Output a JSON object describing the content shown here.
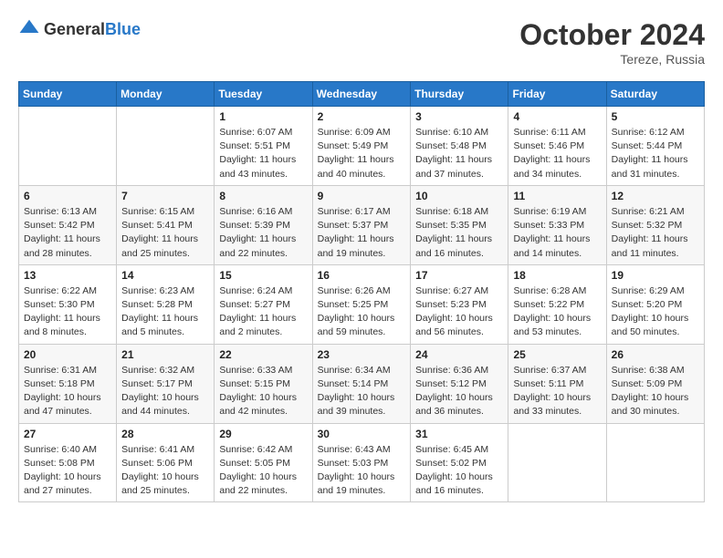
{
  "header": {
    "logo_general": "General",
    "logo_blue": "Blue",
    "month_title": "October 2024",
    "location": "Tereze, Russia"
  },
  "days_of_week": [
    "Sunday",
    "Monday",
    "Tuesday",
    "Wednesday",
    "Thursday",
    "Friday",
    "Saturday"
  ],
  "weeks": [
    [
      {
        "day": "",
        "info": ""
      },
      {
        "day": "",
        "info": ""
      },
      {
        "day": "1",
        "info": "Sunrise: 6:07 AM\nSunset: 5:51 PM\nDaylight: 11 hours and 43 minutes."
      },
      {
        "day": "2",
        "info": "Sunrise: 6:09 AM\nSunset: 5:49 PM\nDaylight: 11 hours and 40 minutes."
      },
      {
        "day": "3",
        "info": "Sunrise: 6:10 AM\nSunset: 5:48 PM\nDaylight: 11 hours and 37 minutes."
      },
      {
        "day": "4",
        "info": "Sunrise: 6:11 AM\nSunset: 5:46 PM\nDaylight: 11 hours and 34 minutes."
      },
      {
        "day": "5",
        "info": "Sunrise: 6:12 AM\nSunset: 5:44 PM\nDaylight: 11 hours and 31 minutes."
      }
    ],
    [
      {
        "day": "6",
        "info": "Sunrise: 6:13 AM\nSunset: 5:42 PM\nDaylight: 11 hours and 28 minutes."
      },
      {
        "day": "7",
        "info": "Sunrise: 6:15 AM\nSunset: 5:41 PM\nDaylight: 11 hours and 25 minutes."
      },
      {
        "day": "8",
        "info": "Sunrise: 6:16 AM\nSunset: 5:39 PM\nDaylight: 11 hours and 22 minutes."
      },
      {
        "day": "9",
        "info": "Sunrise: 6:17 AM\nSunset: 5:37 PM\nDaylight: 11 hours and 19 minutes."
      },
      {
        "day": "10",
        "info": "Sunrise: 6:18 AM\nSunset: 5:35 PM\nDaylight: 11 hours and 16 minutes."
      },
      {
        "day": "11",
        "info": "Sunrise: 6:19 AM\nSunset: 5:33 PM\nDaylight: 11 hours and 14 minutes."
      },
      {
        "day": "12",
        "info": "Sunrise: 6:21 AM\nSunset: 5:32 PM\nDaylight: 11 hours and 11 minutes."
      }
    ],
    [
      {
        "day": "13",
        "info": "Sunrise: 6:22 AM\nSunset: 5:30 PM\nDaylight: 11 hours and 8 minutes."
      },
      {
        "day": "14",
        "info": "Sunrise: 6:23 AM\nSunset: 5:28 PM\nDaylight: 11 hours and 5 minutes."
      },
      {
        "day": "15",
        "info": "Sunrise: 6:24 AM\nSunset: 5:27 PM\nDaylight: 11 hours and 2 minutes."
      },
      {
        "day": "16",
        "info": "Sunrise: 6:26 AM\nSunset: 5:25 PM\nDaylight: 10 hours and 59 minutes."
      },
      {
        "day": "17",
        "info": "Sunrise: 6:27 AM\nSunset: 5:23 PM\nDaylight: 10 hours and 56 minutes."
      },
      {
        "day": "18",
        "info": "Sunrise: 6:28 AM\nSunset: 5:22 PM\nDaylight: 10 hours and 53 minutes."
      },
      {
        "day": "19",
        "info": "Sunrise: 6:29 AM\nSunset: 5:20 PM\nDaylight: 10 hours and 50 minutes."
      }
    ],
    [
      {
        "day": "20",
        "info": "Sunrise: 6:31 AM\nSunset: 5:18 PM\nDaylight: 10 hours and 47 minutes."
      },
      {
        "day": "21",
        "info": "Sunrise: 6:32 AM\nSunset: 5:17 PM\nDaylight: 10 hours and 44 minutes."
      },
      {
        "day": "22",
        "info": "Sunrise: 6:33 AM\nSunset: 5:15 PM\nDaylight: 10 hours and 42 minutes."
      },
      {
        "day": "23",
        "info": "Sunrise: 6:34 AM\nSunset: 5:14 PM\nDaylight: 10 hours and 39 minutes."
      },
      {
        "day": "24",
        "info": "Sunrise: 6:36 AM\nSunset: 5:12 PM\nDaylight: 10 hours and 36 minutes."
      },
      {
        "day": "25",
        "info": "Sunrise: 6:37 AM\nSunset: 5:11 PM\nDaylight: 10 hours and 33 minutes."
      },
      {
        "day": "26",
        "info": "Sunrise: 6:38 AM\nSunset: 5:09 PM\nDaylight: 10 hours and 30 minutes."
      }
    ],
    [
      {
        "day": "27",
        "info": "Sunrise: 6:40 AM\nSunset: 5:08 PM\nDaylight: 10 hours and 27 minutes."
      },
      {
        "day": "28",
        "info": "Sunrise: 6:41 AM\nSunset: 5:06 PM\nDaylight: 10 hours and 25 minutes."
      },
      {
        "day": "29",
        "info": "Sunrise: 6:42 AM\nSunset: 5:05 PM\nDaylight: 10 hours and 22 minutes."
      },
      {
        "day": "30",
        "info": "Sunrise: 6:43 AM\nSunset: 5:03 PM\nDaylight: 10 hours and 19 minutes."
      },
      {
        "day": "31",
        "info": "Sunrise: 6:45 AM\nSunset: 5:02 PM\nDaylight: 10 hours and 16 minutes."
      },
      {
        "day": "",
        "info": ""
      },
      {
        "day": "",
        "info": ""
      }
    ]
  ]
}
